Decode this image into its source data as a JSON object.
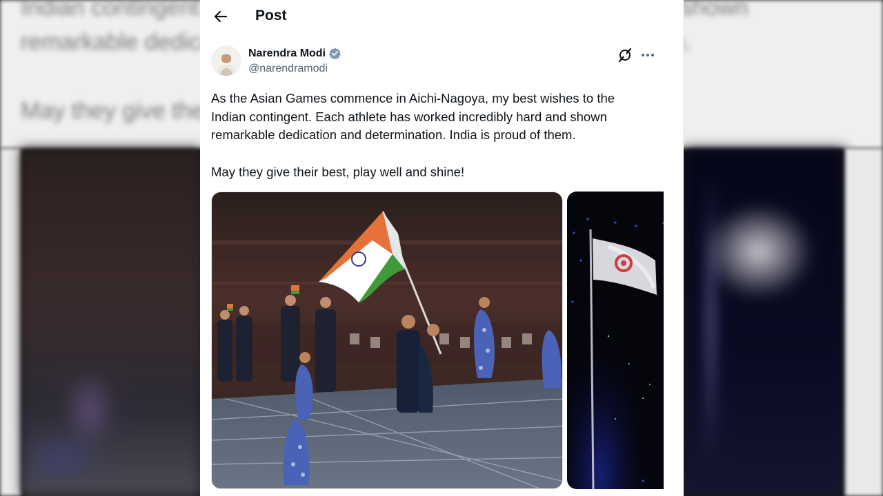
{
  "backdrop": {
    "text_line1": "Indian contingent. Each athlete has worked incredibly hard and shown",
    "text_line2": "remarkable dedication and determination. India is proud of them.",
    "text_line3": "May they give their best, play well and shine!"
  },
  "header": {
    "title": "Post"
  },
  "author": {
    "name": "Narendra Modi",
    "handle": "@narendramodi"
  },
  "post": {
    "text": "As the Asian Games commence in Aichi-Nagoya, my best wishes to the\nIndian contingent. Each athlete has worked incredibly hard and shown\nremarkable dedication and determination. India is proud of them.\n\nMay they give their best, play well and shine!"
  },
  "icons": {
    "back": "arrow-left-icon",
    "verified": "verified-badge-icon",
    "grok": "grok-icon",
    "more": "more-options-icon"
  },
  "colors": {
    "text_primary": "#0f1419",
    "text_secondary": "#536471",
    "verified_badge": "#829aab",
    "saffron": "#e4723a",
    "green": "#3f9b3a"
  }
}
